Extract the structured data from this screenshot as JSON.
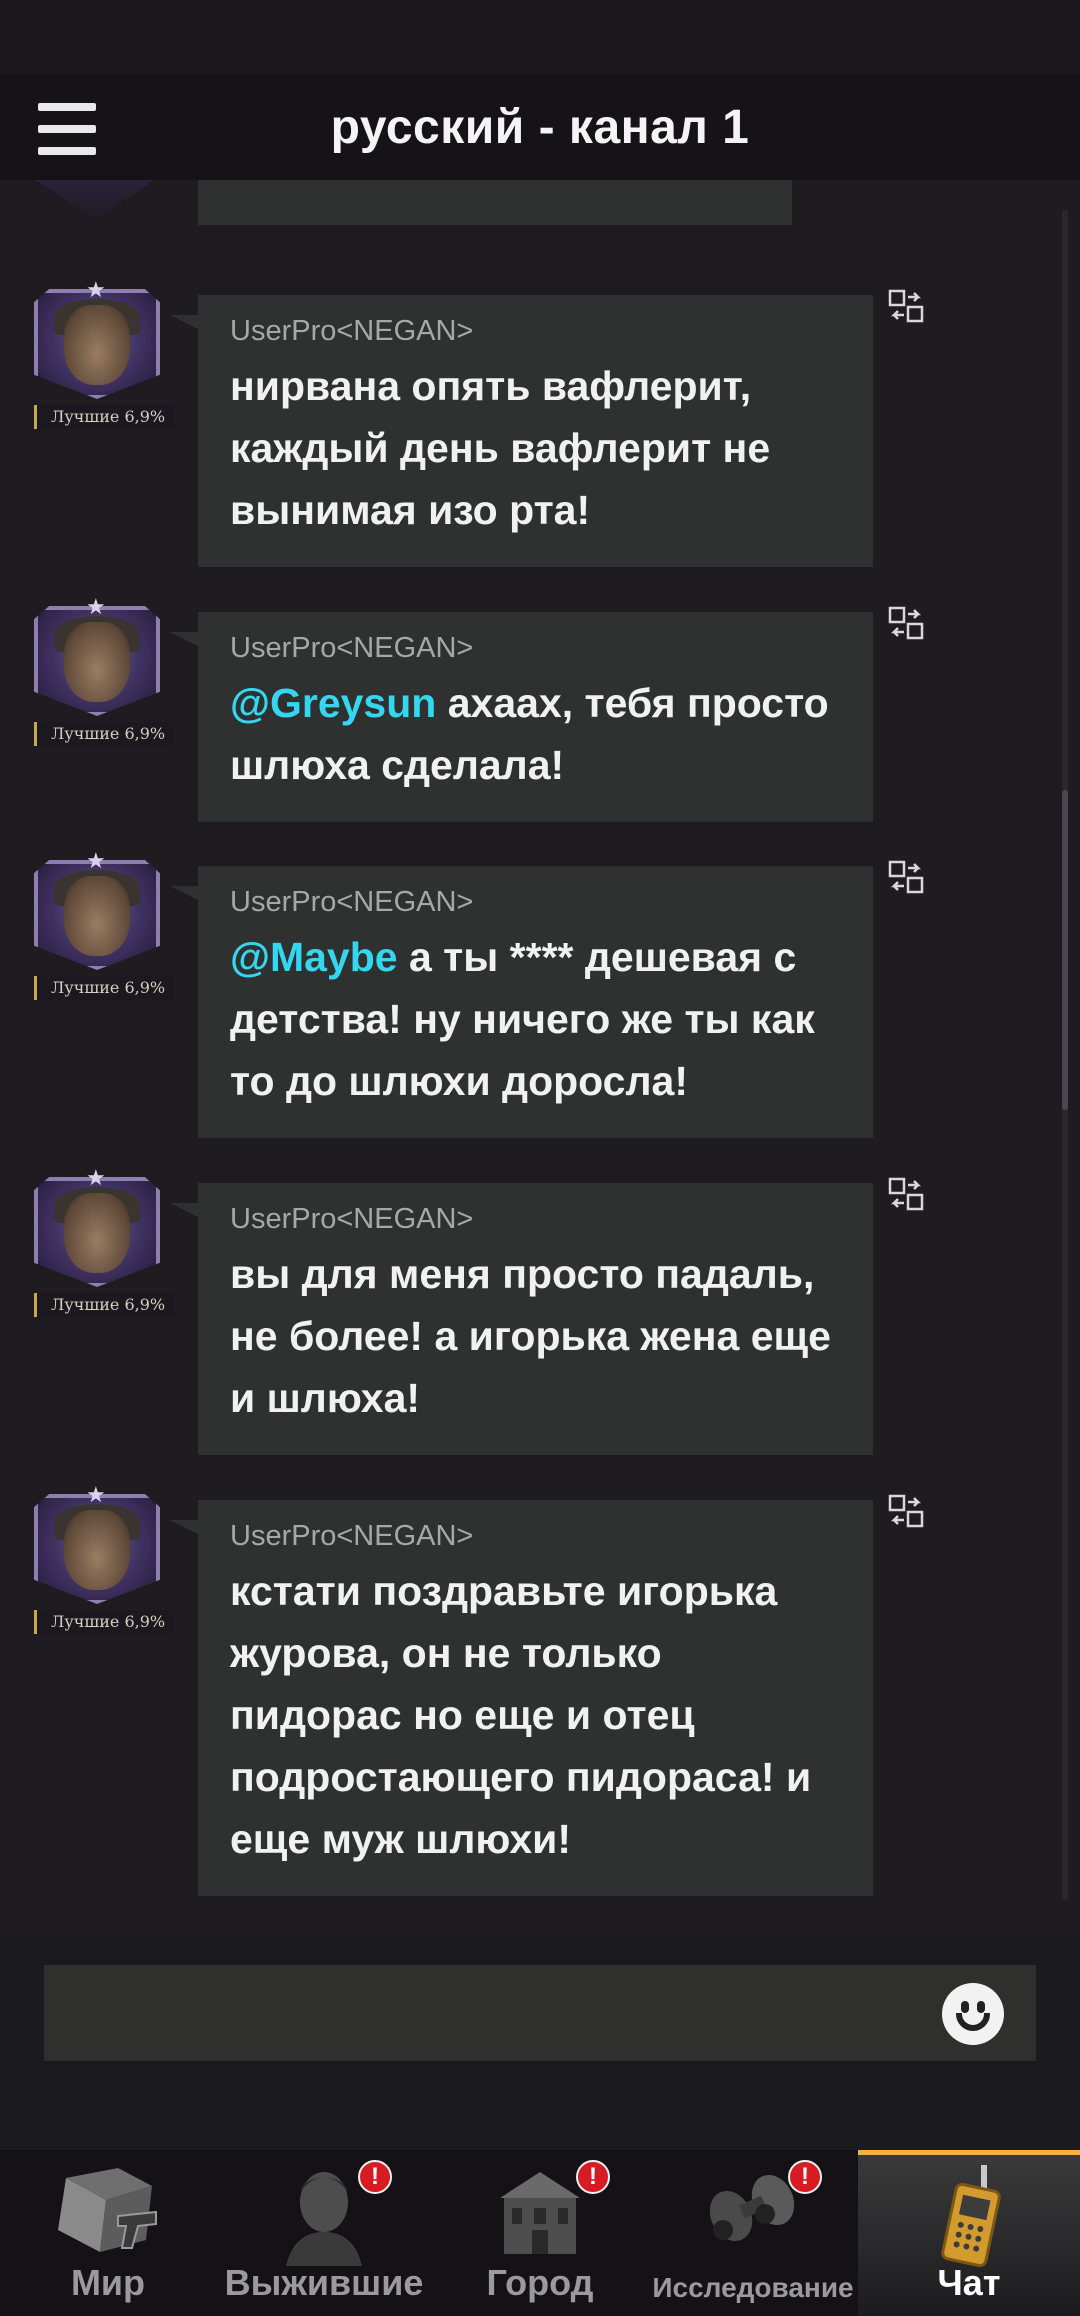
{
  "header": {
    "title": "русский - канал 1"
  },
  "messages": [
    {
      "sender": "UserPro<NEGAN>",
      "badge": "Лучшие 6,9%",
      "mention": "",
      "text": "нирвана опять вафлерит, каждый день вафлерит не вынимая изо рта!"
    },
    {
      "sender": "UserPro<NEGAN>",
      "badge": "Лучшие 6,9%",
      "mention": "@Greysun",
      "text": " ахаах, тебя просто шлюха сделала!"
    },
    {
      "sender": "UserPro<NEGAN>",
      "badge": "Лучшие 6,9%",
      "mention": "@Maybe",
      "text": " а ты **** дешевая с детства! ну ничего же ты как то до шлюхи доросла!"
    },
    {
      "sender": "UserPro<NEGAN>",
      "badge": "Лучшие 6,9%",
      "mention": "",
      "text": "вы для меня просто падаль, не более! а игорька жена еще и шлюха!"
    },
    {
      "sender": "UserPro<NEGAN>",
      "badge": "Лучшие 6,9%",
      "mention": "",
      "text": "кстати поздравьте игорька журова, он не только пидорас но еще и отец подростающего пидораса! и еще муж шлюхи!"
    }
  ],
  "nav": {
    "items": [
      {
        "label": "Мир",
        "badge": ""
      },
      {
        "label": "Выжившие",
        "badge": "!"
      },
      {
        "label": "Город",
        "badge": "!"
      },
      {
        "label": "Исследование",
        "badge": "!"
      },
      {
        "label": "Чат",
        "badge": ""
      }
    ]
  },
  "colors": {
    "accent": "#f1b43e",
    "mention": "#35d6ef",
    "bubble": "#2e312f",
    "badge": "#d61c22"
  }
}
